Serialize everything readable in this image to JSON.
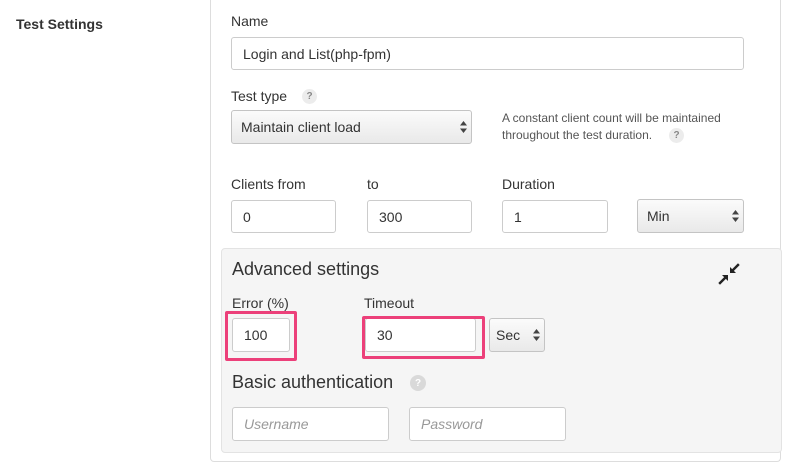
{
  "section": {
    "label": "Test Settings"
  },
  "name": {
    "label": "Name",
    "value": "Login and List(php-fpm)"
  },
  "test_type": {
    "label": "Test type",
    "help": "?",
    "selected": "Maintain client load",
    "note_line1": "A constant client count will be maintained",
    "note_line2": "throughout the test duration.",
    "note_help": "?"
  },
  "clients": {
    "from_label": "Clients from",
    "from_value": "0",
    "to_label": "to",
    "to_value": "300"
  },
  "duration": {
    "label": "Duration",
    "value": "1",
    "unit": "Min"
  },
  "advanced": {
    "title": "Advanced settings",
    "error_label": "Error (%)",
    "error_value": "100",
    "timeout_label": "Timeout",
    "timeout_value": "30",
    "timeout_unit": "Sec",
    "auth_title": "Basic authentication",
    "auth_help": "?",
    "username_placeholder": "Username",
    "password_placeholder": "Password"
  },
  "colors": {
    "highlight": "#ec407a",
    "panel_bg": "#f5f5f5"
  },
  "icons": {
    "collapse": "compress-arrows-icon",
    "select": "updown-arrows-icon"
  }
}
